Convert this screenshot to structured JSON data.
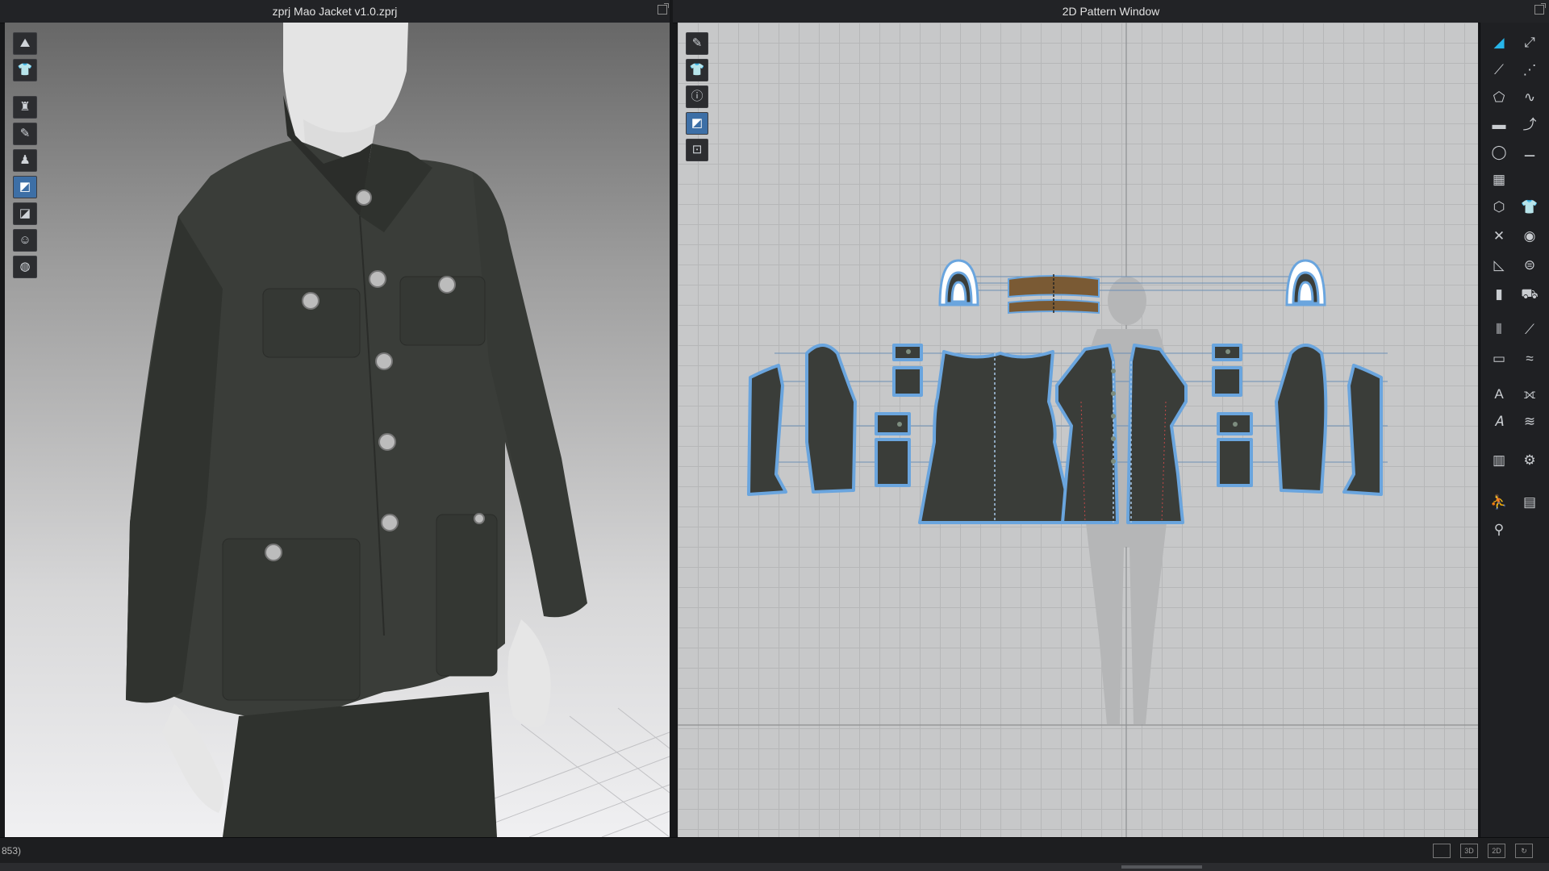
{
  "windows": {
    "view3d_title": "zprj Mao Jacket v1.0.zprj",
    "view2d_title": "2D Pattern Window"
  },
  "toolbars": {
    "view3d_tools": [
      "simulation-icon",
      "garment-icon",
      "fit-icon",
      "select-mesh-icon",
      "pin-icon",
      "fold-icon",
      "texture-icon",
      "avatar-icon",
      "globe-icon"
    ],
    "view2d_tools": [
      "transform-pattern-icon",
      "garment-display-icon",
      "info-icon",
      "texture-tool-icon",
      "lock-icon"
    ],
    "right_tools_left": [
      "edit-pattern-icon",
      "edit-curve-icon",
      "polygon-icon",
      "rectangle-icon",
      "circle-icon",
      "internal-polygon-icon",
      "trace-icon",
      "cut-icon",
      "dart-icon",
      "segment-sewing-icon",
      "free-sewing-icon",
      "pleat-icon",
      "text-icon",
      "text-2-icon",
      "grid-icon",
      "avatar-measure-icon",
      "pin-tool-icon"
    ],
    "right_tools_right": [
      "transform-icon",
      "edit-point-icon",
      "curve-point-icon",
      "fold-arrangement-icon",
      "ironing-icon",
      "shirt-icon",
      "button-icon",
      "buttonhole-icon",
      "topstitch-icon",
      "zipper-icon",
      "measure-icon",
      "fold-line-icon",
      "elastic-icon",
      "stitch-icon",
      "graphic-icon",
      "table-icon"
    ]
  },
  "status": {
    "left_text": "853)",
    "view_buttons": [
      "",
      "3D",
      "2D",
      "↻"
    ]
  },
  "colors": {
    "fabric": "#3a3d39",
    "pattern_outline": "#6aa5de",
    "belt": "#7a5a34",
    "accent": "#3d6fa6"
  }
}
